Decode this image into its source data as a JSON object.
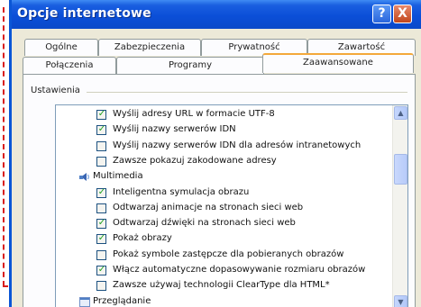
{
  "window": {
    "title": "Opcje internetowe",
    "help_label": "?",
    "close_label": "X"
  },
  "tabs": {
    "row1": [
      "Ogólne",
      "Zabezpieczenia",
      "Prywatność",
      "Zawartość"
    ],
    "row2": [
      "Połączenia",
      "Programy",
      "Zaawansowane"
    ],
    "active": "Zaawansowane"
  },
  "settings": {
    "group_label": "Ustawienia",
    "items": [
      {
        "type": "checkbox",
        "checked": true,
        "label": "Wyślij adresy URL w formacie UTF-8"
      },
      {
        "type": "checkbox",
        "checked": true,
        "label": "Wyślij nazwy serwerów IDN"
      },
      {
        "type": "checkbox",
        "checked": false,
        "label": "Wyślij nazwy serwerów IDN dla adresów intranetowych"
      },
      {
        "type": "checkbox",
        "checked": false,
        "label": "Zawsze pokazuj zakodowane adresy"
      },
      {
        "type": "category",
        "icon": "multimedia-icon",
        "label": "Multimedia"
      },
      {
        "type": "checkbox",
        "checked": true,
        "label": "Inteligentna symulacja obrazu"
      },
      {
        "type": "checkbox",
        "checked": false,
        "label": "Odtwarzaj animacje na stronach sieci web"
      },
      {
        "type": "checkbox",
        "checked": true,
        "label": "Odtwarzaj dźwięki na stronach sieci web"
      },
      {
        "type": "checkbox",
        "checked": true,
        "label": "Pokaż obrazy"
      },
      {
        "type": "checkbox",
        "checked": false,
        "label": "Pokaż symbole zastępcze dla pobieranych obrazów"
      },
      {
        "type": "checkbox",
        "checked": true,
        "label": "Włącz automatyczne dopasowywanie rozmiaru obrazów"
      },
      {
        "type": "checkbox",
        "checked": false,
        "label": "Zawsze używaj technologii ClearType dla HTML*"
      },
      {
        "type": "category",
        "icon": "browsing-icon",
        "label": "Przeglądanie"
      }
    ]
  },
  "colors": {
    "annotation": "#d81e1e",
    "titlebar": "#0b4fd8",
    "check": "#21a121"
  }
}
